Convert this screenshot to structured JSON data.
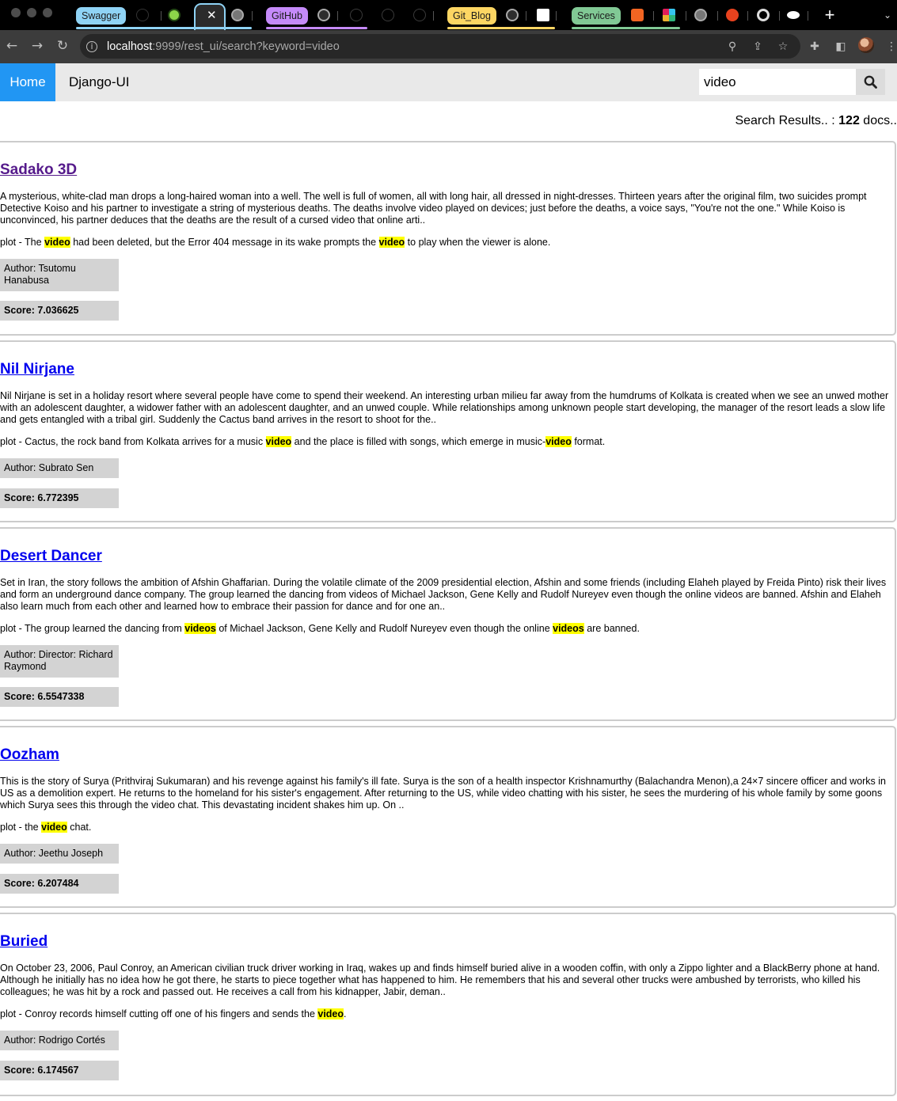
{
  "browser": {
    "tab_groups": [
      {
        "label": "Swagger",
        "color": "#8fd3f5"
      },
      {
        "label": "GitHub",
        "color": "#c58af9"
      },
      {
        "label": "Git_Blog",
        "color": "#fcd663"
      },
      {
        "label": "Services",
        "color": "#81c995"
      }
    ],
    "close_glyph": "✕",
    "new_tab_glyph": "+",
    "url_host": "localhost",
    "url_rest": ":9999/rest_ui/search?keyword=video"
  },
  "nav": {
    "home_label": "Home",
    "brand": "Django-UI",
    "search_value": "video",
    "accent": "#2196f3"
  },
  "summary": {
    "prefix": "Search Results.. : ",
    "count": "122",
    "suffix": " docs.."
  },
  "results": [
    {
      "title": "Sadako 3D",
      "title_color": "#551a8b",
      "description": "A mysterious, white-clad man drops a long-haired woman into a well. The well is full of women, all with long hair, all dressed in night-dresses. Thirteen years after the original film, two suicides prompt Detective Koiso and his partner to investigate a string of mysterious deaths. The deaths involve video played on devices; just before the deaths, a voice says, \"You're not the one.\" While Koiso is unconvinced, his partner deduces that the deaths are the result of a cursed video that online arti..",
      "plot_parts": [
        "plot - The ",
        "video",
        " had been deleted, but the Error 404 message in its wake prompts the ",
        "video",
        " to play when the viewer is alone."
      ],
      "author": "Author: Tsutomu Hanabusa",
      "score": "Score: 7.036625"
    },
    {
      "title": "Nil Nirjane",
      "title_color": "#0000ee",
      "description": "Nil Nirjane is set in a holiday resort where several people have come to spend their weekend. An interesting urban milieu far away from the humdrums of Kolkata is created when we see an unwed mother with an adolescent daughter, a widower father with an adolescent daughter, and an unwed couple. While relationships among unknown people start developing, the manager of the resort leads a slow life and gets entangled with a tribal girl. Suddenly the Cactus band arrives in the resort to shoot for the..",
      "plot_parts": [
        "plot - Cactus, the rock band from Kolkata arrives for a music ",
        "video",
        " and the place is filled with songs, which emerge in music-",
        "video",
        " format."
      ],
      "author": "Author: Subrato Sen",
      "score": "Score: 6.772395"
    },
    {
      "title": "Desert Dancer",
      "title_color": "#0000ee",
      "description": "Set in Iran, the story follows the ambition of Afshin Ghaffarian. During the volatile climate of the 2009 presidential election, Afshin and some friends (including Elaheh played by Freida Pinto) risk their lives and form an underground dance company. The group learned the dancing from videos of Michael Jackson, Gene Kelly and Rudolf Nureyev even though the online videos are banned. Afshin and Elaheh also learn much from each other and learned how to embrace their passion for dance and for one an..",
      "plot_parts": [
        "plot - The group learned the dancing from ",
        "videos",
        " of Michael Jackson, Gene Kelly and Rudolf Nureyev even though the online ",
        "videos",
        " are banned."
      ],
      "author": "Author: Director: Richard Raymond",
      "score": "Score: 6.5547338"
    },
    {
      "title": "Oozham",
      "title_color": "#0000ee",
      "description": "This is the story of Surya (Prithviraj Sukumaran) and his revenge against his family's ill fate. Surya is the son of a health inspector Krishnamurthy (Balachandra Menon),a 24×7 sincere officer and works in US as a demolition expert. He returns to the homeland for his sister's engagement. After returning to the US, while video chatting with his sister, he sees the murdering of his whole family by some goons which Surya sees this through the video chat. This devastating incident shakes him up. On ..",
      "plot_parts": [
        "plot - the ",
        "video",
        " chat."
      ],
      "author": "Author: Jeethu Joseph",
      "score": "Score: 6.207484"
    },
    {
      "title": "Buried",
      "title_color": "#0000ee",
      "description": "On October 23, 2006, Paul Conroy, an American civilian truck driver working in Iraq, wakes up and finds himself buried alive in a wooden coffin, with only a Zippo lighter and a BlackBerry phone at hand. Although he initially has no idea how he got there, he starts to piece together what has happened to him. He remembers that his and several other trucks were ambushed by terrorists, who killed his colleagues; he was hit by a rock and passed out. He receives a call from his kidnapper, Jabir, deman..",
      "plot_parts": [
        "plot - Conroy records himself cutting off one of his fingers and sends the ",
        "video",
        "."
      ],
      "author": "Author: Rodrigo Cortés",
      "score": "Score: 6.174567"
    }
  ]
}
